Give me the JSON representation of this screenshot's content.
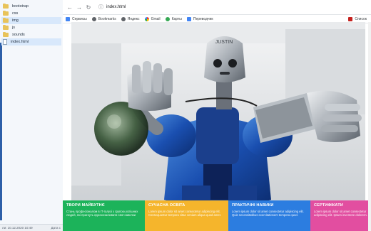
{
  "explorer": {
    "items": [
      {
        "label": "bootstrap",
        "type": "folder"
      },
      {
        "label": "css",
        "type": "folder"
      },
      {
        "label": "img",
        "type": "folder"
      },
      {
        "label": "js",
        "type": "folder"
      },
      {
        "label": "sounds",
        "type": "folder"
      },
      {
        "label": "index.html",
        "type": "file"
      }
    ],
    "status_left": "ли: 10.12.2020 10:49",
    "status_right": "Дата с"
  },
  "browser": {
    "address": "index.html",
    "bookmarks": [
      {
        "label": "Сервисы",
        "icon": "apps-icon",
        "color": "#4285f4"
      },
      {
        "label": "Bookmarks",
        "icon": "globe-icon",
        "color": "#5f6368"
      },
      {
        "label": "Яндекс",
        "icon": "globe-icon",
        "color": "#5f6368"
      },
      {
        "label": "Gmail",
        "icon": "google-icon",
        "color": "#ea4335"
      },
      {
        "label": "Карты",
        "icon": "maps-icon",
        "color": "#34a853"
      },
      {
        "label": "Переводчик",
        "icon": "translate-icon",
        "color": "#4285f4"
      }
    ],
    "bookmarks_right": "Список"
  },
  "cards": [
    {
      "title": "ТВОРИ МАЙБУТНЄ",
      "text": "Стань професіоналом в IT-галузі з групою успішних людей, які прагнуть вдосконалювати свої навички",
      "color": "#1cb35a"
    },
    {
      "title": "СУЧАСНА ОСВІТА",
      "text": "Lorem ipsum dolor sit amet consectetur adipiscing elit. Consequuntur tempora vitae veniam aliqua quod amet.",
      "color": "#f5b52c"
    },
    {
      "title": "ПРАКТИЧНІ НАВИКИ",
      "text": "Lorem ipsum dolor sit amet consectetur adipiscing elit. Quis necessitatibus exercitationem tempora quod.",
      "color": "#2c7de0"
    },
    {
      "title": "СЕРТИФІКАТИ",
      "text": "Lorem ipsum dolor sit amet consectetur adipiscing elit. Ipsum inventore dolorem.",
      "color": "#e24ea0"
    }
  ]
}
